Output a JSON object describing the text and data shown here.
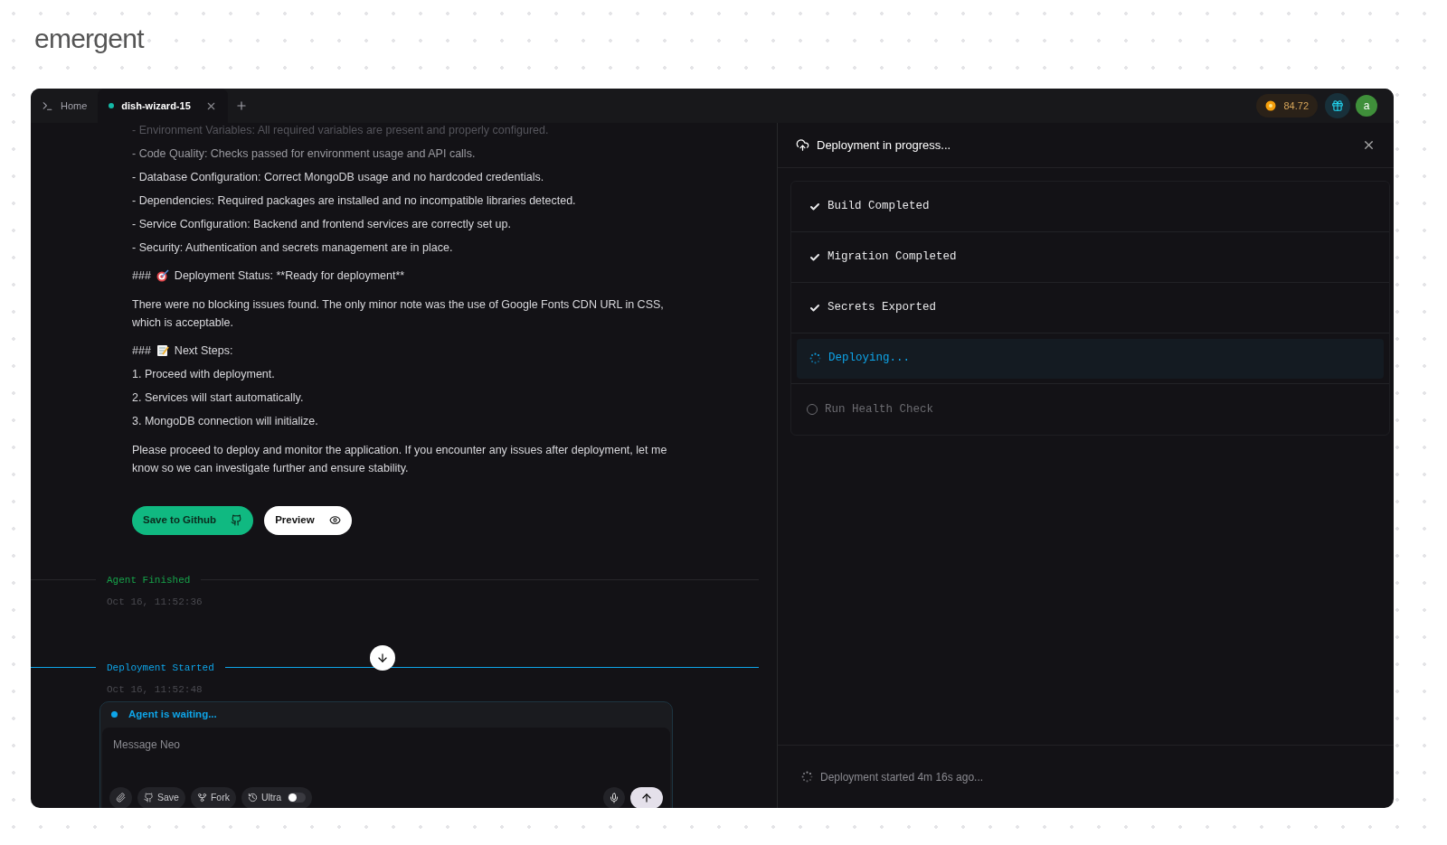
{
  "brand": {
    "logo": "emergent"
  },
  "tabs": [
    {
      "label": "Home",
      "selected": false,
      "kind": "home"
    },
    {
      "label": "dish-wizard-15",
      "selected": true,
      "kind": "task"
    }
  ],
  "credits": "84.72",
  "avatar": "a",
  "chat": {
    "lines": [
      {
        "kind": "faded",
        "text": "- Environment Variables: All required variables are present and properly configured."
      },
      {
        "kind": "dim",
        "text": "- Code Quality: Checks passed for environment usage and API calls."
      },
      {
        "kind": "plain",
        "text": "- Database Configuration: Correct MongoDB usage and no hardcoded credentials."
      },
      {
        "kind": "plain",
        "text": "- Dependencies: Required packages are installed and no incompatible libraries detected."
      },
      {
        "kind": "plain",
        "text": "- Service Configuration: Backend and frontend services are correctly set up."
      },
      {
        "kind": "plain",
        "text": "- Security: Authentication and secrets management are in place."
      },
      {
        "kind": "heading-target",
        "prefix": "###",
        "text": "Deployment Status: **Ready for deployment**"
      },
      {
        "kind": "para",
        "text": "There were no blocking issues found. The only minor note was the use of Google Fonts CDN URL in CSS, which is acceptable."
      },
      {
        "kind": "heading-memo",
        "prefix": "###",
        "text": "Next Steps:"
      },
      {
        "kind": "plain",
        "text": "1. Proceed with deployment."
      },
      {
        "kind": "plain",
        "text": "2. Services will start automatically."
      },
      {
        "kind": "plain",
        "text": "3. MongoDB connection will initialize."
      },
      {
        "kind": "para",
        "text": "Please proceed to deploy and monitor the application. If you encounter any issues after deployment, let me know so we can investigate further and ensure stability."
      }
    ],
    "buttons": [
      {
        "label": "Save to Github",
        "kind": "github"
      },
      {
        "label": "Preview",
        "kind": "preview"
      }
    ],
    "events": [
      {
        "title": "Agent Finished",
        "time": "Oct 16, 11:52:36",
        "color": "#16a34a"
      },
      {
        "title": "Deployment Started",
        "time": "Oct 16, 11:52:48",
        "color": "#0ea5e9"
      }
    ],
    "status": "Agent is waiting...",
    "input": {
      "placeholder": "Message Neo"
    },
    "tools": [
      {
        "kind": "attach"
      },
      {
        "kind": "save",
        "label": "Save"
      },
      {
        "kind": "fork",
        "label": "Fork"
      },
      {
        "kind": "ultra",
        "label": "Ultra",
        "on": false
      }
    ]
  },
  "deploy": {
    "title": "Deployment in progress...",
    "steps": [
      {
        "label": "Build Completed",
        "kind": "done"
      },
      {
        "label": "Migration Completed",
        "kind": "done"
      },
      {
        "label": "Secrets Exported",
        "kind": "done"
      },
      {
        "label": "Deploying...",
        "kind": "active"
      },
      {
        "label": "Run Health Check",
        "kind": "pending"
      }
    ],
    "footer": "Deployment started 4m 16s ago..."
  }
}
